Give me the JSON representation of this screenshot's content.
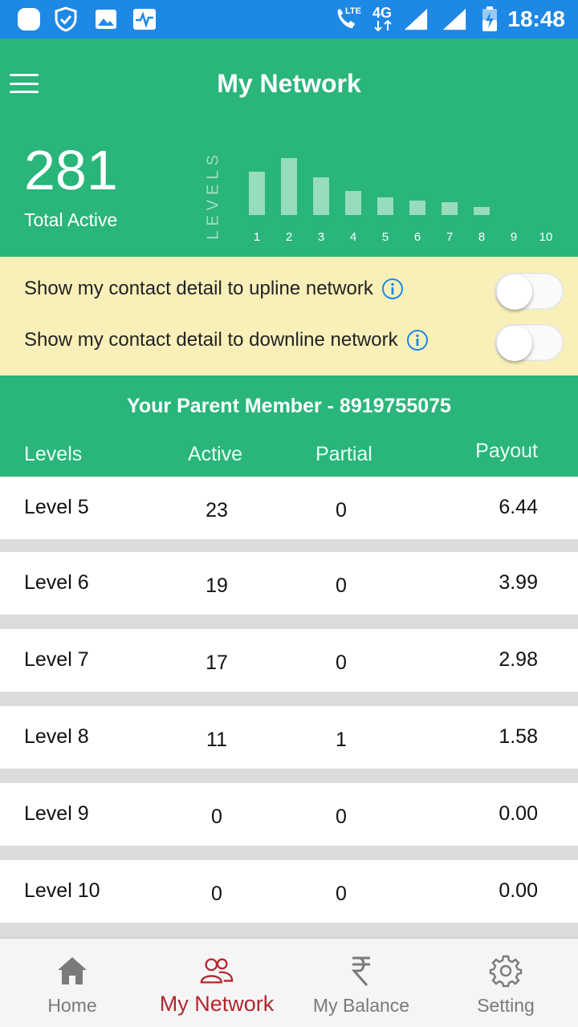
{
  "statusbar": {
    "network_lte": "LTE",
    "network_4g": "4G",
    "time": "18:48"
  },
  "appbar": {
    "title": "My Network",
    "menu_icon": "hamburger-icon"
  },
  "summary": {
    "total_active": "281",
    "total_label": "Total Active",
    "levels_vertical_label": "LEVELS"
  },
  "chart_data": {
    "type": "bar",
    "categories": [
      "1",
      "2",
      "3",
      "4",
      "5",
      "6",
      "7",
      "8",
      "9",
      "10"
    ],
    "values": [
      54,
      71,
      47,
      30,
      22,
      18,
      16,
      10,
      0,
      0
    ],
    "ylim": [
      0,
      80
    ],
    "grid": false,
    "colors": {
      "bar": "#97dcbb"
    }
  },
  "settings": {
    "upline_label": "Show my contact detail to upline network",
    "downline_label": "Show my contact detail to downline network",
    "upline_enabled": false,
    "downline_enabled": false
  },
  "table": {
    "parent_member": "Your Parent Member - 8919755075",
    "headers": {
      "level": "Levels",
      "active": "Active",
      "partial": "Partial",
      "payout": "Payout"
    },
    "rows": [
      {
        "level": "Level 5",
        "active": "23",
        "partial": "0",
        "payout": "6.44"
      },
      {
        "level": "Level 6",
        "active": "19",
        "partial": "0",
        "payout": "3.99"
      },
      {
        "level": "Level 7",
        "active": "17",
        "partial": "0",
        "payout": "2.98"
      },
      {
        "level": "Level 8",
        "active": "11",
        "partial": "1",
        "payout": "1.58"
      },
      {
        "level": "Level 9",
        "active": "0",
        "partial": "0",
        "payout": "0.00"
      },
      {
        "level": "Level 10",
        "active": "0",
        "partial": "0",
        "payout": "0.00"
      }
    ]
  },
  "bottom_nav": {
    "items": [
      {
        "label": "Home",
        "icon": "home-icon"
      },
      {
        "label": "My Network",
        "icon": "people-icon",
        "active": true
      },
      {
        "label": "My Balance",
        "icon": "rupee-icon"
      },
      {
        "label": "Setting",
        "icon": "gear-icon"
      }
    ]
  },
  "colors": {
    "status_bar": "#1e88e5",
    "primary_green": "#2ab57a",
    "toggle_panel": "#f9f0b9",
    "active_nav": "#b3262e",
    "info_blue": "#1e88e5"
  }
}
